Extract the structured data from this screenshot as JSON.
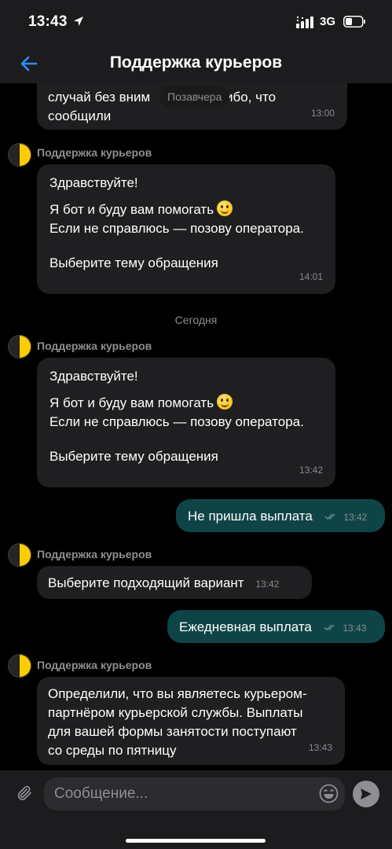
{
  "status_bar": {
    "time": "13:43",
    "network": "3G"
  },
  "header": {
    "title": "Поддержка курьеров"
  },
  "chat": {
    "old_message": {
      "line1_left": "случай без вним",
      "line1_right": "ибо, что",
      "line2": "сообщили",
      "time": "13:00"
    },
    "day_pill": "Позавчера",
    "bot_message_1": {
      "sender": "Поддержка курьеров",
      "greeting": "Здравствуйте!",
      "line_bot": "Я бот и буду вам помогать",
      "line_operator": "Если не справлюсь — позову оператора.",
      "line_topic": "Выберите тему обращения",
      "time": "14:01"
    },
    "day_separator": "Сегодня",
    "bot_message_2": {
      "sender": "Поддержка курьеров",
      "greeting": "Здравствуйте!",
      "line_bot": "Я бот и буду вам помогать",
      "line_operator": "Если не справлюсь — позову оператора.",
      "line_topic": "Выберите тему обращения",
      "time": "13:42"
    },
    "user_message_1": {
      "text": "Не пришла выплата",
      "time": "13:42"
    },
    "bot_message_3": {
      "sender": "Поддержка курьеров",
      "text": "Выберите подходящий вариант",
      "time": "13:42"
    },
    "user_message_2": {
      "text": "Ежедневная выплата",
      "time": "13:43"
    },
    "bot_message_4": {
      "sender": "Поддержка курьеров",
      "text": "Определили, что вы являетесь курьером-\nпартнёром курьерской службы. Выплаты\nдля вашей формы занятости поступают\nсо среды по пятницу",
      "time": "13:43"
    }
  },
  "input": {
    "placeholder": "Сообщение..."
  },
  "colors": {
    "background": "#000000",
    "incoming_bubble": "#1f1f21",
    "outgoing_bubble": "#0f4447",
    "accent_blue": "#2f8cff",
    "avatar_yellow": "#ffcc00"
  }
}
